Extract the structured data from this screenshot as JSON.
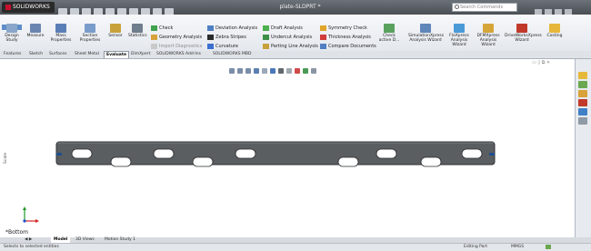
{
  "app": {
    "name": "SOLIDWORKS",
    "document_title": "plate-SLDPRT *",
    "search_placeholder": "Search Commands"
  },
  "toolbar": {
    "large_buttons": [
      {
        "label": "Design Study",
        "icon": "design-study-icon"
      },
      {
        "label": "Measure",
        "icon": "measure-icon"
      },
      {
        "label": "Mass Properties",
        "icon": "mass-properties-icon"
      },
      {
        "label": "Section Properties",
        "icon": "section-properties-icon"
      },
      {
        "label": "Sensor",
        "icon": "sensor-icon"
      },
      {
        "label": "Statistics",
        "icon": "statistics-icon"
      }
    ],
    "group1": [
      "Check",
      "Geometry Analysis",
      "Import Diagnostics"
    ],
    "group2": [
      "Deviation Analysis",
      "Zebra Stripes",
      "Curvature"
    ],
    "group3": [
      "Draft Analysis",
      "Undercut Analysis",
      "Parting Line Analysis"
    ],
    "group4": [
      "Symmetry Check",
      "Thickness Analysis",
      "Compare Documents"
    ],
    "check_active": "Check active D...",
    "right_buttons": [
      {
        "label": "SimulationXpress Analysis Wizard",
        "icon": "simulation-icon"
      },
      {
        "label": "FloXpress Analysis Wizard",
        "icon": "floxpress-icon"
      },
      {
        "label": "DFMXpress Analysis Wizard",
        "icon": "dfmxpress-icon"
      },
      {
        "label": "DriveWorksXpress Wizard",
        "icon": "driveworks-icon"
      },
      {
        "label": "Costing",
        "icon": "costing-icon"
      }
    ]
  },
  "tabs": [
    "Features",
    "Sketch",
    "Surfaces",
    "Sheet Metal",
    "Evaluate",
    "DimXpert",
    "SOLIDWORKS Add-Ins",
    "SOLIDWORKS MBD"
  ],
  "active_tab": "Evaluate",
  "viewport": {
    "units_label": "Scale",
    "part_holes": 9,
    "view_name": "*Bottom",
    "axis_triad": "triad-icon"
  },
  "bottom_tabs": [
    "Model",
    "3D Views",
    "Motion Study 1"
  ],
  "active_bottom_tab": "Model",
  "status": {
    "left": "Selects to selected entities",
    "editing": "Editing Part",
    "units": "MMGS"
  },
  "colors": {
    "part_body": "#5b5e61",
    "part_edge": "#2f3235",
    "accent_blue": "#1f4e8c",
    "axis_red": "#d42020",
    "axis_green": "#1f9a2a",
    "axis_blue": "#1f4fcf"
  }
}
